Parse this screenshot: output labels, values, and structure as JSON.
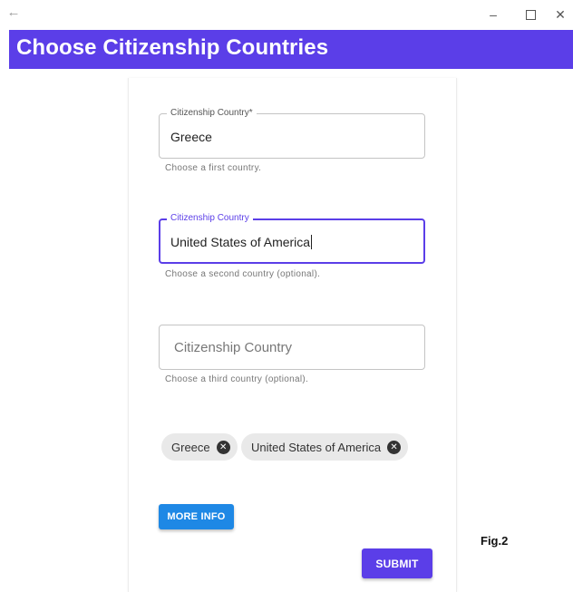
{
  "window": {
    "back_icon": "arrow-left-icon",
    "minimize_glyph": "–",
    "close_glyph": "✕"
  },
  "header": {
    "title": "Choose Citizenship Countries",
    "background": "#5b3ee8"
  },
  "form": {
    "field1": {
      "label": "Citizenship Country*",
      "value": "Greece",
      "helper": "Choose a first country."
    },
    "field2": {
      "label": "Citizenship Country",
      "value": "United States of America",
      "helper": "Choose a second country (optional).",
      "focused": true
    },
    "field3": {
      "placeholder": "Citizenship Country",
      "helper": "Choose a third country (optional)."
    }
  },
  "chips": [
    {
      "label": "Greece",
      "icon": "cancel-icon"
    },
    {
      "label": "United States of America",
      "icon": "cancel-icon"
    }
  ],
  "buttons": {
    "more_info": "MORE INFO",
    "submit": "SUBMIT"
  },
  "colors": {
    "accent": "#5b3ee8",
    "info_button": "#1e88e5"
  },
  "figure_label": "Fig.2"
}
